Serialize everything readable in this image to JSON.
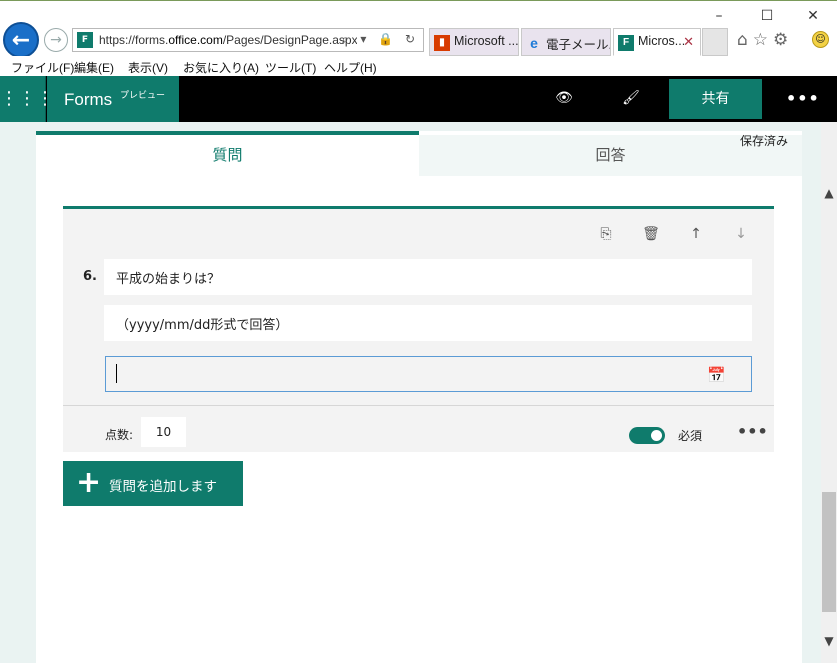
{
  "browser": {
    "url_prefix": "https://forms.",
    "url_domain": "office.com",
    "url_path": "/Pages/DesignPage.aspx",
    "favicon": "F",
    "tabs": [
      {
        "label": "Microsoft ...",
        "icon": "office-icon"
      },
      {
        "label": "電子メール...",
        "icon": "ie-icon"
      },
      {
        "label": "Micros...",
        "icon": "forms-icon"
      }
    ],
    "window_controls": {
      "minimize": "–",
      "maximize": "☐",
      "close": "✕"
    },
    "toolbar_icons": "⌂☆⚙",
    "address_icons": "⌕ ▾ 🔒 ↻"
  },
  "menu": [
    {
      "label": "ファイル(F)"
    },
    {
      "label": "編集(E)"
    },
    {
      "label": "表示(V)"
    },
    {
      "label": "お気に入り(A)"
    },
    {
      "label": "ツール(T)"
    },
    {
      "label": "ヘルプ(H)"
    }
  ],
  "appbar": {
    "brand": "Forms",
    "brand_sub": "プレビュー",
    "share": "共有",
    "more": "•••",
    "waffle": "⋮⋮⋮",
    "preview_icon": "👁",
    "theme_icon": "🖌"
  },
  "tabs": {
    "questions": "質問",
    "responses": "回答"
  },
  "status": {
    "saved": "保存済み"
  },
  "question": {
    "number": "6.",
    "title": "平成の始まりは？",
    "subtitle": "（yyyy/mm/dd形式で回答）",
    "date_value": "",
    "points_label": "点数:",
    "points_value": "10",
    "required_label": "必須",
    "required": true,
    "more": "•••"
  },
  "add_question": {
    "plus": "+",
    "label": "質問を追加します"
  },
  "colors": {
    "accent": "#0f7b6c",
    "appbar": "#000000",
    "page_bg": "#eaf3f2"
  }
}
